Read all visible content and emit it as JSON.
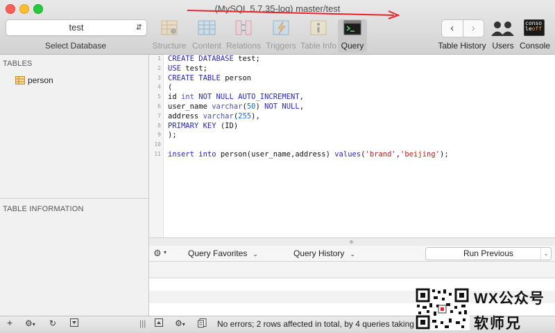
{
  "window": {
    "title": "(MySQL 5.7.35-log) master/test"
  },
  "database_selector": {
    "value": "test",
    "label": "Select Database"
  },
  "toolbar": {
    "tools": [
      {
        "label": "Structure",
        "icon": "structure-icon"
      },
      {
        "label": "Content",
        "icon": "content-icon"
      },
      {
        "label": "Relations",
        "icon": "relations-icon"
      },
      {
        "label": "Triggers",
        "icon": "triggers-icon"
      },
      {
        "label": "Table Info",
        "icon": "table-info-icon"
      },
      {
        "label": "Query",
        "icon": "query-icon"
      }
    ],
    "right": {
      "table_history": "Table History",
      "users": "Users",
      "console": "Console",
      "console_icon_text_1": "conso",
      "console_icon_text_2": "le",
      "console_icon_text_3": "off"
    }
  },
  "sidebar": {
    "tables_header": "TABLES",
    "tables": [
      "person"
    ],
    "table_info_header": "TABLE INFORMATION"
  },
  "editor": {
    "line_numbers": [
      "1",
      "2",
      "3",
      "4",
      "5",
      "6",
      "7",
      "8",
      "9",
      "10",
      "11"
    ],
    "lines": [
      [
        {
          "t": "CREATE DATABASE ",
          "c": "kw"
        },
        {
          "t": "test;",
          "c": ""
        }
      ],
      [
        {
          "t": "USE ",
          "c": "kw"
        },
        {
          "t": "test;",
          "c": ""
        }
      ],
      [
        {
          "t": "CREATE TABLE ",
          "c": "kw"
        },
        {
          "t": "person",
          "c": ""
        }
      ],
      [
        {
          "t": "(",
          "c": ""
        }
      ],
      [
        {
          "t": "id ",
          "c": ""
        },
        {
          "t": "int ",
          "c": "ty"
        },
        {
          "t": "NOT NULL AUTO_INCREMENT",
          "c": "kw"
        },
        {
          "t": ",",
          "c": ""
        }
      ],
      [
        {
          "t": "user_name ",
          "c": ""
        },
        {
          "t": "varchar",
          "c": "ty"
        },
        {
          "t": "(",
          "c": ""
        },
        {
          "t": "50",
          "c": "nm"
        },
        {
          "t": ") ",
          "c": ""
        },
        {
          "t": "NOT NULL",
          "c": "kw"
        },
        {
          "t": ",",
          "c": ""
        }
      ],
      [
        {
          "t": "address ",
          "c": ""
        },
        {
          "t": "varchar",
          "c": "ty"
        },
        {
          "t": "(",
          "c": ""
        },
        {
          "t": "255",
          "c": "nm"
        },
        {
          "t": "),",
          "c": ""
        }
      ],
      [
        {
          "t": "PRIMARY KEY ",
          "c": "kw"
        },
        {
          "t": "(ID)",
          "c": ""
        }
      ],
      [
        {
          "t": ");",
          "c": ""
        }
      ],
      [],
      [
        {
          "t": "insert into ",
          "c": "kw"
        },
        {
          "t": "person(user_name,address) ",
          "c": ""
        },
        {
          "t": "values",
          "c": "kw"
        },
        {
          "t": "(",
          "c": ""
        },
        {
          "t": "'brand'",
          "c": "st"
        },
        {
          "t": ",",
          "c": ""
        },
        {
          "t": "'beijing'",
          "c": "st"
        },
        {
          "t": ");",
          "c": ""
        }
      ]
    ]
  },
  "query_bar": {
    "favorites": "Query Favorites",
    "history": "Query History",
    "run_previous": "Run Previous"
  },
  "status": {
    "message": "No errors; 2 rows affected in total, by 4 queries taking"
  },
  "watermark": {
    "line1": "WX公众号",
    "line2": "软师兄"
  },
  "colors": {
    "keyword": "#2525c4",
    "type": "#4a4ad0",
    "number": "#1a6cc0",
    "string": "#c41a16",
    "annotation_arrow": "#e8232a"
  }
}
